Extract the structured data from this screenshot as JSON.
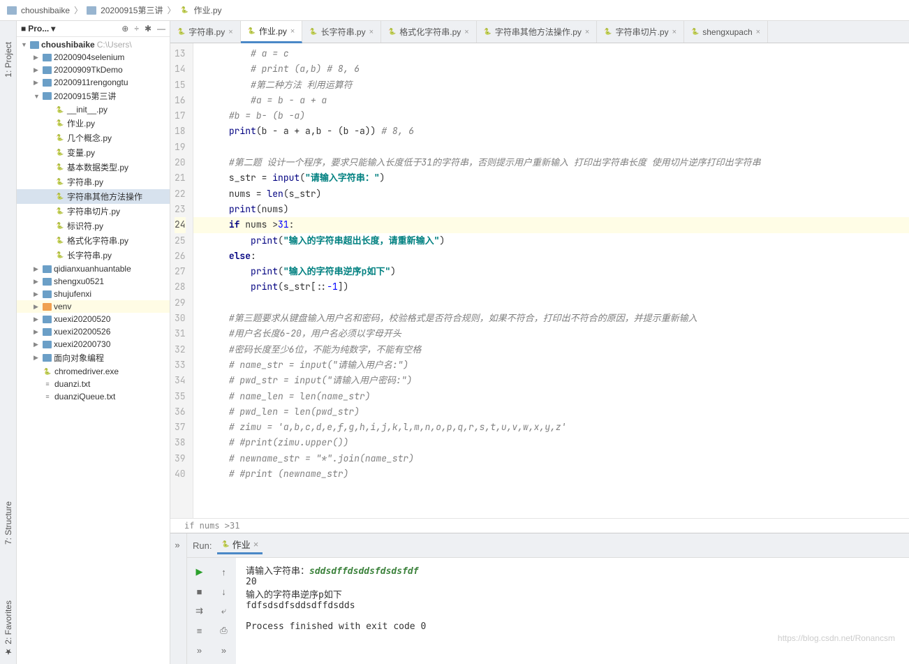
{
  "breadcrumb": {
    "root": "choushibaike",
    "mid": "20200915第三讲",
    "file": "作业.py"
  },
  "sidebar": {
    "title": "Pro...",
    "root": "choushibaike",
    "root_extra": "C:\\Users\\",
    "items": [
      {
        "d": 1,
        "kind": "folder",
        "arrow": "▶",
        "label": "20200904selenium"
      },
      {
        "d": 1,
        "kind": "folder",
        "arrow": "▶",
        "label": "20200909TkDemo"
      },
      {
        "d": 1,
        "kind": "folder",
        "arrow": "▶",
        "label": "20200911rengongtu"
      },
      {
        "d": 1,
        "kind": "folder",
        "arrow": "▼",
        "label": "20200915第三讲"
      },
      {
        "d": 2,
        "kind": "py",
        "label": "__init__.py"
      },
      {
        "d": 2,
        "kind": "py",
        "label": "作业.py"
      },
      {
        "d": 2,
        "kind": "py",
        "label": "几个概念.py"
      },
      {
        "d": 2,
        "kind": "py",
        "label": "变量.py"
      },
      {
        "d": 2,
        "kind": "py",
        "label": "基本数据类型.py"
      },
      {
        "d": 2,
        "kind": "py",
        "label": "字符串.py"
      },
      {
        "d": 2,
        "kind": "py",
        "label": "字符串其他方法操作",
        "sel": true
      },
      {
        "d": 2,
        "kind": "py",
        "label": "字符串切片.py"
      },
      {
        "d": 2,
        "kind": "py",
        "label": "标识符.py"
      },
      {
        "d": 2,
        "kind": "py",
        "label": "格式化字符串.py"
      },
      {
        "d": 2,
        "kind": "py",
        "label": "长字符串.py"
      },
      {
        "d": 1,
        "kind": "folder",
        "arrow": "▶",
        "label": "qidianxuanhuantable"
      },
      {
        "d": 1,
        "kind": "folder",
        "arrow": "▶",
        "label": "shengxu0521"
      },
      {
        "d": 1,
        "kind": "folder",
        "arrow": "▶",
        "label": "shujufenxi"
      },
      {
        "d": 1,
        "kind": "folder-orange",
        "arrow": "▶",
        "label": "venv",
        "hl": true
      },
      {
        "d": 1,
        "kind": "folder",
        "arrow": "▶",
        "label": "xuexi20200520"
      },
      {
        "d": 1,
        "kind": "folder",
        "arrow": "▶",
        "label": "xuexi20200526"
      },
      {
        "d": 1,
        "kind": "folder",
        "arrow": "▶",
        "label": "xuexi20200730"
      },
      {
        "d": 1,
        "kind": "folder",
        "arrow": "▶",
        "label": "面向对象编程"
      },
      {
        "d": 1,
        "kind": "py",
        "label": "chromedriver.exe"
      },
      {
        "d": 1,
        "kind": "txt",
        "label": "duanzi.txt"
      },
      {
        "d": 1,
        "kind": "txt",
        "label": "duanziQueue.txt"
      }
    ]
  },
  "tabs": [
    {
      "label": "字符串.py"
    },
    {
      "label": "作业.py",
      "active": true
    },
    {
      "label": "长字符串.py"
    },
    {
      "label": "格式化字符串.py"
    },
    {
      "label": "字符串其他方法操作.py"
    },
    {
      "label": "字符串切片.py"
    },
    {
      "label": "shengxupach"
    }
  ],
  "code": {
    "start": 13,
    "crumb": "if nums >31",
    "lines": [
      {
        "html": "<span class=\"cm\"># a = c</span>",
        "i": 2
      },
      {
        "html": "<span class=\"cm\"># print (a,b) # 8, 6</span>",
        "i": 2
      },
      {
        "html": "<span class=\"cm\">#第二种方法 利用运算符</span>",
        "i": 2
      },
      {
        "html": "<span class=\"cm\">#a = b - a + a</span>",
        "i": 2
      },
      {
        "html": "<span class=\"cm\">#b = b- (b -a)</span>",
        "i": 1
      },
      {
        "html": "<span class=\"fn\">print</span>(b - a + a,b - (b -a)) <span class=\"cm\"># 8, 6</span>",
        "i": 1
      },
      {
        "html": "",
        "i": 1
      },
      {
        "html": "<span class=\"cm\">#第二题 设计一个程序，要求只能输入长度低于31的字符串，否则提示用户重新输入 打印出字符串长度 使用切片逆序打印出字符串</span>",
        "i": 1
      },
      {
        "html": "s_str = <span class=\"fn\">input</span>(<span class=\"str\">\"请输入字符串：\"</span>)",
        "i": 1
      },
      {
        "html": "nums = <span class=\"fn\">len</span>(s_str)",
        "i": 1
      },
      {
        "html": "<span class=\"fn\">print</span>(nums)",
        "i": 1
      },
      {
        "html": "<span class=\"kw\">if</span> nums &gt;<span class=\"num\">31</span>:",
        "i": 1,
        "cur": true
      },
      {
        "html": "<span class=\"fn\">print</span>(<span class=\"str\">\"输入的字符串超出长度，请重新输入\"</span>)",
        "i": 2
      },
      {
        "html": "<span class=\"kw\">else</span>:",
        "i": 1
      },
      {
        "html": "<span class=\"fn\">print</span>(<span class=\"str\">\"输入的字符串逆序p如下\"</span>)",
        "i": 2
      },
      {
        "html": "<span class=\"fn\">print</span>(s_str[::<span class=\"num\">-1</span>])",
        "i": 2
      },
      {
        "html": "",
        "i": 1
      },
      {
        "html": "<span class=\"cm\">#第三题要求从键盘输入用户名和密码，校验格式是否符合规则，如果不符合，打印出不符合的原因，并提示重新输入</span>",
        "i": 1
      },
      {
        "html": "<span class=\"cm\">#用户名长度6-20，用户名必须以字母开头</span>",
        "i": 1
      },
      {
        "html": "<span class=\"cm\">#密码长度至少6位，不能为纯数字，不能有空格</span>",
        "i": 1
      },
      {
        "html": "<span class=\"cm\"># name_str = input(\"请输入用户名:\")</span>",
        "i": 1
      },
      {
        "html": "<span class=\"cm\"># pwd_str = input(\"请输入用户密码:\")</span>",
        "i": 1
      },
      {
        "html": "<span class=\"cm\"># name_len = len(name_str)</span>",
        "i": 1
      },
      {
        "html": "<span class=\"cm\"># pwd_len = len(pwd_str)</span>",
        "i": 1
      },
      {
        "html": "<span class=\"cm\"># zimu = 'a,b,c,d,e,f,g,h,i,j,k,l,m,n,o,p,q,r,s,t,u,v,w,x,y,z'</span>",
        "i": 1
      },
      {
        "html": "<span class=\"cm\"># #print(zimu.upper())</span>",
        "i": 1
      },
      {
        "html": "<span class=\"cm\"># newname_str = \"*\".join(name_str)</span>",
        "i": 1
      },
      {
        "html": "<span class=\"cm\"># #print (newname_str)</span>",
        "i": 1
      }
    ]
  },
  "left_tabs": {
    "project": "1: Project",
    "structure": "7: Structure",
    "favorites": "2: Favorites"
  },
  "run": {
    "label": "Run:",
    "tab": "作业",
    "prompt": "请输入字符串：",
    "input": "sddsdffdsddsfdsdsfdf",
    "count": "20",
    "msg": "输入的字符串逆序p如下",
    "rev": "fdfsdsdfsddsdffdsdds",
    "exit": "Process finished with exit code 0"
  },
  "watermark": "https://blog.csdn.net/Ronancsm"
}
